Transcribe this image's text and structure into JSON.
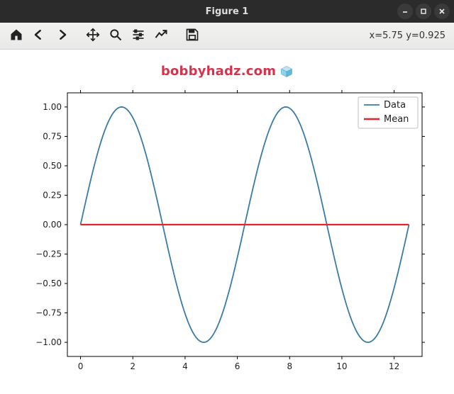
{
  "window": {
    "title": "Figure 1"
  },
  "toolbar": {
    "coord_text": "x=5.75 y=0.925"
  },
  "watermark": {
    "text": "bobbyhadz.com"
  },
  "chart_data": {
    "type": "line",
    "title": "",
    "xlabel": "",
    "ylabel": "",
    "xlim": [
      0,
      12.566
    ],
    "ylim": [
      -1.0,
      1.0
    ],
    "xticks": [
      0,
      2,
      4,
      6,
      8,
      10,
      12
    ],
    "yticks": [
      -1.0,
      -0.75,
      -0.5,
      -0.25,
      0.0,
      0.25,
      0.5,
      0.75,
      1.0
    ],
    "xtick_labels": [
      "0",
      "2",
      "4",
      "6",
      "8",
      "10",
      "12"
    ],
    "ytick_labels": [
      "−1.00",
      "−0.75",
      "−0.50",
      "−0.25",
      "0.00",
      "0.25",
      "0.50",
      "0.75",
      "1.00"
    ],
    "series": [
      {
        "name": "Data",
        "color": "#3a7ca5",
        "description": "sin(x) sampled over [0, 4π]",
        "x": [
          0,
          0.5,
          1.0,
          1.5708,
          2.0,
          2.5,
          3.0,
          3.1416,
          3.5,
          4.0,
          4.5,
          4.7124,
          5.0,
          5.5,
          6.0,
          6.2832,
          6.5,
          7.0,
          7.5,
          7.854,
          8.0,
          8.5,
          9.0,
          9.4248,
          9.5,
          10.0,
          10.5,
          10.9956,
          11.0,
          11.5,
          12.0,
          12.566
        ],
        "y": [
          0,
          0.4794,
          0.8415,
          1.0,
          0.9093,
          0.5985,
          0.1411,
          0.0,
          -0.3508,
          -0.7568,
          -0.9775,
          -1.0,
          -0.9589,
          -0.7055,
          -0.2794,
          0.0,
          0.2151,
          0.657,
          0.938,
          1.0,
          0.9894,
          0.7985,
          0.4121,
          0.0,
          -0.0752,
          -0.544,
          -0.8797,
          -1.0,
          -0.9999,
          -0.8755,
          -0.5366,
          0.0
        ]
      },
      {
        "name": "Mean",
        "color": "#e4252e",
        "x": [
          0,
          12.566
        ],
        "y": [
          0.0,
          0.0
        ]
      }
    ],
    "legend": {
      "entries": [
        "Data",
        "Mean"
      ],
      "position": "upper right"
    }
  }
}
